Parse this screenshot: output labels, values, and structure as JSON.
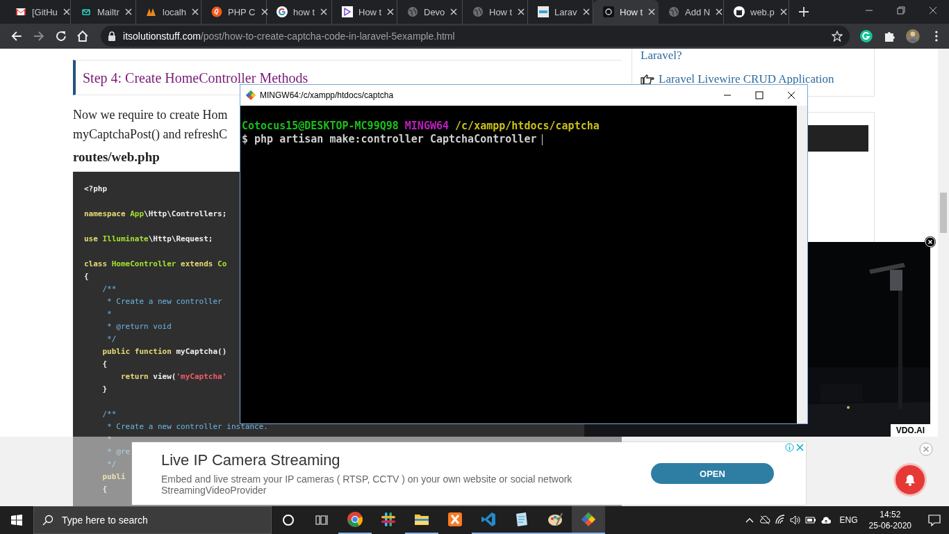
{
  "browser": {
    "tabs": [
      {
        "title": "[GitHu",
        "kind": "mail",
        "selected": false
      },
      {
        "title": "Mailtr",
        "kind": "envelope",
        "selected": false
      },
      {
        "title": "localh",
        "kind": "arches",
        "selected": false
      },
      {
        "title": "PHP C",
        "kind": "swirl",
        "selected": false
      },
      {
        "title": "how t",
        "kind": "search",
        "selected": false
      },
      {
        "title": "How t",
        "kind": "play",
        "selected": false
      },
      {
        "title": "Devo",
        "kind": "globe",
        "selected": false
      },
      {
        "title": "How t",
        "kind": "globe",
        "selected": false
      },
      {
        "title": "Larav",
        "kind": "stripe",
        "selected": false
      },
      {
        "title": "How t",
        "kind": "ring",
        "selected": true
      },
      {
        "title": "Add N",
        "kind": "globe",
        "selected": false
      },
      {
        "title": "web.p",
        "kind": "cat",
        "selected": false
      }
    ],
    "address": {
      "domain": "itsolutionstuff.com",
      "path": "/post/how-to-create-captcha-code-in-laravel-5example.html"
    }
  },
  "article": {
    "heading": "Step 4: Create HomeController Methods",
    "paragraph_lines": [
      "Now we require to create Hom",
      "myCaptchaPost() and refreshC"
    ],
    "file_label": "routes/web.php",
    "code_blocks": [
      [
        {
          "tokens": [
            {
              "kind": "plain",
              "text": "<?php"
            }
          ]
        }
      ],
      [
        {
          "tokens": [
            {
              "kind": "kw",
              "text": "namespace"
            },
            {
              "kind": "name",
              "text": " App"
            },
            {
              "kind": "plain",
              "text": "\\Http\\Controllers;"
            }
          ]
        }
      ],
      [
        {
          "tokens": [
            {
              "kind": "kw",
              "text": "use"
            },
            {
              "kind": "name",
              "text": " Illuminate"
            },
            {
              "kind": "plain",
              "text": "\\Http\\Request;"
            }
          ]
        }
      ],
      [
        {
          "tokens": [
            {
              "kind": "kw",
              "text": "class"
            },
            {
              "kind": "name",
              "text": " HomeController"
            },
            {
              "kind": "kw",
              "text": " extends"
            },
            {
              "kind": "name",
              "text": " Co"
            }
          ]
        },
        {
          "tokens": [
            {
              "kind": "plain",
              "text": "{"
            }
          ]
        },
        {
          "tokens": [
            {
              "kind": "comment",
              "text": "    /**"
            }
          ]
        },
        {
          "tokens": [
            {
              "kind": "comment",
              "text": "     * Create a new controller"
            }
          ]
        },
        {
          "tokens": [
            {
              "kind": "comment",
              "text": "     *"
            }
          ]
        },
        {
          "tokens": [
            {
              "kind": "comment",
              "text": "     * @return void"
            }
          ]
        },
        {
          "tokens": [
            {
              "kind": "comment",
              "text": "     */"
            }
          ]
        },
        {
          "tokens": [
            {
              "kind": "kw",
              "text": "    public function"
            },
            {
              "kind": "plain",
              "text": " myCaptcha()"
            }
          ]
        },
        {
          "tokens": [
            {
              "kind": "plain",
              "text": "    {"
            }
          ]
        },
        {
          "tokens": [
            {
              "kind": "kw",
              "text": "        return"
            },
            {
              "kind": "plain",
              "text": " view("
            },
            {
              "kind": "string",
              "text": "'myCaptcha'"
            }
          ]
        },
        {
          "tokens": [
            {
              "kind": "plain",
              "text": "    }"
            }
          ]
        }
      ],
      [
        {
          "tokens": [
            {
              "kind": "comment",
              "text": "    /**"
            }
          ]
        },
        {
          "tokens": [
            {
              "kind": "comment",
              "text": "     * Create a new controller instance."
            }
          ]
        },
        {
          "tokens": [
            {
              "kind": "comment",
              "text": "     *"
            }
          ]
        },
        {
          "tokens": [
            {
              "kind": "comment",
              "text": "     * @re"
            }
          ]
        },
        {
          "tokens": [
            {
              "kind": "comment",
              "text": "     */"
            }
          ]
        },
        {
          "tokens": [
            {
              "kind": "kw",
              "text": "    publi"
            }
          ]
        },
        {
          "tokens": [
            {
              "kind": "plain",
              "text": "    {"
            }
          ]
        }
      ]
    ]
  },
  "sidebar": {
    "links": [
      "Laravel?",
      "Laravel Livewire CRUD Application"
    ]
  },
  "terminal": {
    "title": "MINGW64:/c/xampp/htdocs/captcha",
    "user_host": "Cotocus15@DESKTOP-MC99Q98",
    "system": "MINGW64",
    "path": "/c/xampp/htdocs/captcha",
    "command": "$ php artisan make:controller CaptchaController"
  },
  "video": {
    "brand": "VDO.AI"
  },
  "ad": {
    "title": "Live IP Camera Streaming",
    "description": "Embed and live stream your IP cameras ( RTSP, CCTV ) on your own website or social network",
    "advertiser": "StreamingVideoProvider",
    "button": "OPEN"
  },
  "taskbar": {
    "search_placeholder": "Type here to search",
    "apps": [
      {
        "kind": "browser",
        "running": true,
        "selected": false
      },
      {
        "kind": "hash",
        "running": false,
        "selected": false
      },
      {
        "kind": "folder",
        "running": true,
        "selected": false
      },
      {
        "kind": "cross",
        "running": false,
        "selected": false
      },
      {
        "kind": "editor",
        "running": true,
        "selected": false
      },
      {
        "kind": "notepad",
        "running": true,
        "selected": false
      },
      {
        "kind": "palette",
        "running": true,
        "selected": false
      },
      {
        "kind": "diamond",
        "running": true,
        "selected": true
      }
    ],
    "language": "ENG",
    "time": "14:52",
    "date": "25-06-2020"
  }
}
